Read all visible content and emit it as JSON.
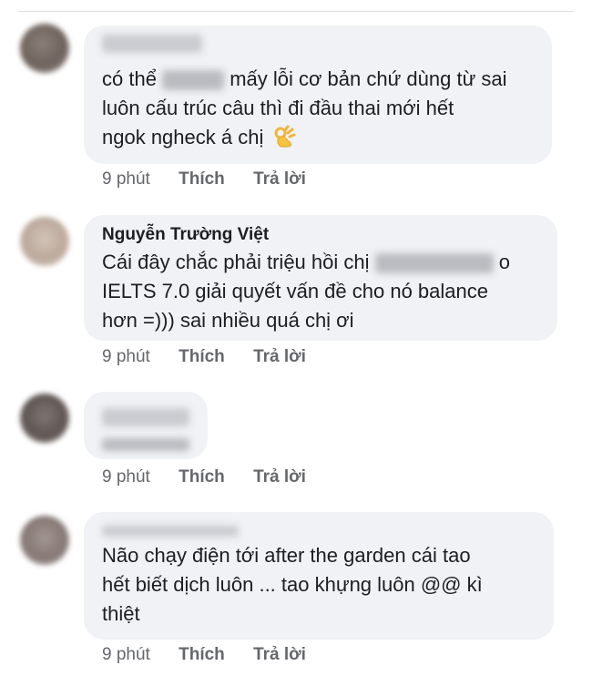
{
  "comments": [
    {
      "author": "",
      "lines": [
        "có thể",
        "mấy lỗi cơ bản chứ dùng từ sai",
        "luôn cấu trúc câu thì đi đầu thai mới hết",
        "ngok ngheck á chị"
      ],
      "emoji": "ok-hand-icon",
      "time": "9 phút",
      "like": "Thích",
      "reply": "Trả lời"
    },
    {
      "author": "Nguyễn Trường Việt",
      "lines": [
        "Cái đây chắc phải triệu hồi chị",
        "o",
        "IELTS 7.0 giải quyết vấn đề cho nó balance",
        "hơn =))) sai nhiều quá chị ơi"
      ],
      "time": "9 phút",
      "like": "Thích",
      "reply": "Trả lời"
    },
    {
      "author": "",
      "lines": [],
      "time": "9 phút",
      "like": "Thích",
      "reply": "Trả lời"
    },
    {
      "author": "",
      "lines": [
        "Não chạy điện tới after the garden cái tao",
        "hết biết dịch luôn ... tao khựng luôn @@ kì",
        "thiệt"
      ],
      "time": "9 phút",
      "like": "Thích",
      "reply": "Trả lời"
    }
  ],
  "colors": {
    "bubble": "#f0f2f5",
    "meta_text": "#65676b",
    "text": "#1c1e21"
  }
}
